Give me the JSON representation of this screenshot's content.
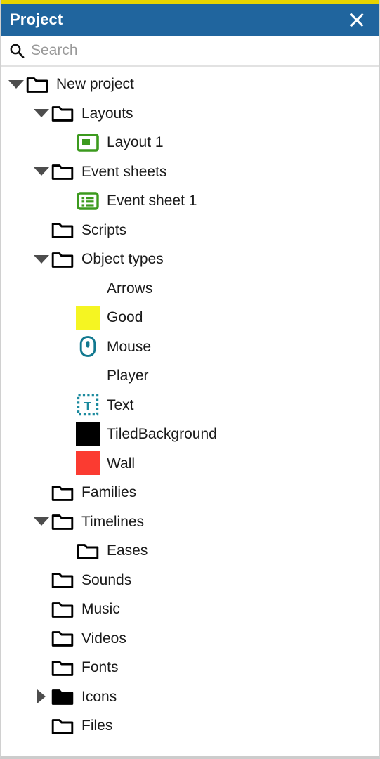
{
  "window": {
    "title": "Project",
    "close_icon": "close-icon",
    "accent_color": "#e8d400",
    "titlebar_color": "#20659e"
  },
  "search": {
    "placeholder": "Search",
    "value": "",
    "icon": "search-icon"
  },
  "tree": {
    "nodes": [
      {
        "label": "New project",
        "depth": 0,
        "twisty": "down",
        "icon": "folder-outline-icon",
        "icon_color": "#000000"
      },
      {
        "label": "Layouts",
        "depth": 1,
        "twisty": "down",
        "icon": "folder-outline-icon",
        "icon_color": "#000000"
      },
      {
        "label": "Layout 1",
        "depth": 2,
        "twisty": "none",
        "icon": "layout-icon",
        "icon_color": "#3c9a1e"
      },
      {
        "label": "Event sheets",
        "depth": 1,
        "twisty": "down",
        "icon": "folder-outline-icon",
        "icon_color": "#000000"
      },
      {
        "label": "Event sheet 1",
        "depth": 2,
        "twisty": "none",
        "icon": "event-sheet-icon",
        "icon_color": "#3c9a1e"
      },
      {
        "label": "Scripts",
        "depth": 1,
        "twisty": "none",
        "icon": "folder-outline-icon",
        "icon_color": "#000000"
      },
      {
        "label": "Object types",
        "depth": 1,
        "twisty": "down",
        "icon": "folder-outline-icon",
        "icon_color": "#000000"
      },
      {
        "label": "Arrows",
        "depth": 2,
        "twisty": "none",
        "icon": "blank-icon",
        "icon_color": ""
      },
      {
        "label": "Good",
        "depth": 2,
        "twisty": "none",
        "icon": "color-chip-icon",
        "icon_color": "#f5f522"
      },
      {
        "label": "Mouse",
        "depth": 2,
        "twisty": "none",
        "icon": "mouse-icon",
        "icon_color": "#11788f"
      },
      {
        "label": "Player",
        "depth": 2,
        "twisty": "none",
        "icon": "blank-icon",
        "icon_color": ""
      },
      {
        "label": "Text",
        "depth": 2,
        "twisty": "none",
        "icon": "text-object-icon",
        "icon_color": "#1b8a9e"
      },
      {
        "label": "TiledBackground",
        "depth": 2,
        "twisty": "none",
        "icon": "color-chip-icon",
        "icon_color": "#000000"
      },
      {
        "label": "Wall",
        "depth": 2,
        "twisty": "none",
        "icon": "color-chip-icon",
        "icon_color": "#fb3b31"
      },
      {
        "label": "Families",
        "depth": 1,
        "twisty": "none",
        "icon": "folder-outline-icon",
        "icon_color": "#000000"
      },
      {
        "label": "Timelines",
        "depth": 1,
        "twisty": "down",
        "icon": "folder-outline-icon",
        "icon_color": "#000000"
      },
      {
        "label": "Eases",
        "depth": 2,
        "twisty": "none",
        "icon": "folder-outline-icon",
        "icon_color": "#000000"
      },
      {
        "label": "Sounds",
        "depth": 1,
        "twisty": "none",
        "icon": "folder-outline-icon",
        "icon_color": "#000000"
      },
      {
        "label": "Music",
        "depth": 1,
        "twisty": "none",
        "icon": "folder-outline-icon",
        "icon_color": "#000000"
      },
      {
        "label": "Videos",
        "depth": 1,
        "twisty": "none",
        "icon": "folder-outline-icon",
        "icon_color": "#000000"
      },
      {
        "label": "Fonts",
        "depth": 1,
        "twisty": "none",
        "icon": "folder-outline-icon",
        "icon_color": "#000000"
      },
      {
        "label": "Icons",
        "depth": 1,
        "twisty": "right",
        "icon": "folder-filled-icon",
        "icon_color": "#000000"
      },
      {
        "label": "Files",
        "depth": 1,
        "twisty": "none",
        "icon": "folder-outline-icon",
        "icon_color": "#000000"
      }
    ]
  }
}
